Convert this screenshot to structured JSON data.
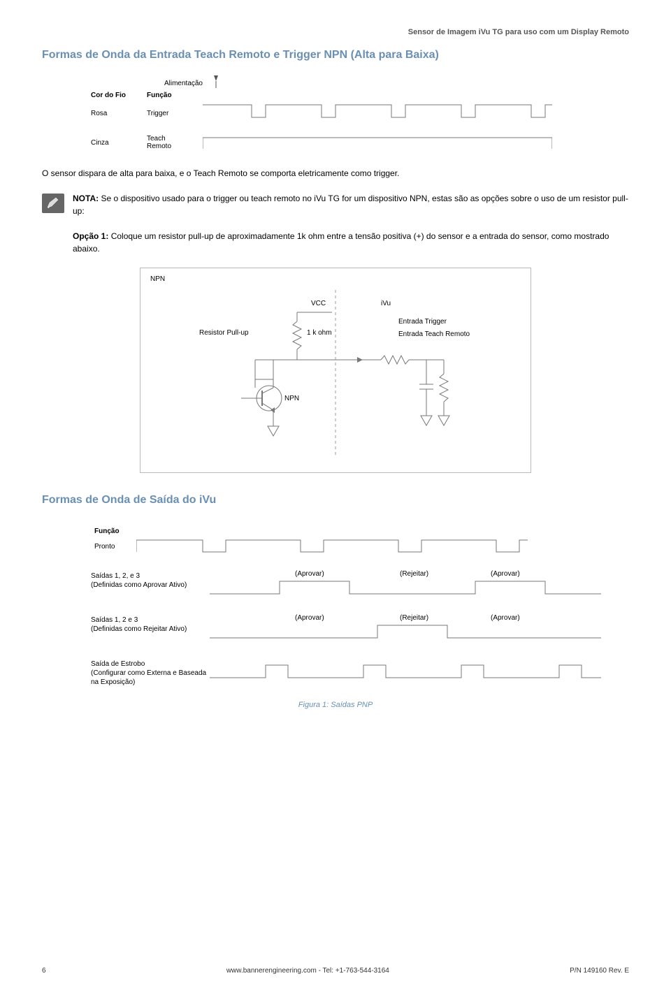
{
  "doc_header": "Sensor de Imagem iVu TG para uso com um Display Remoto",
  "section1_title": "Formas de Onda da Entrada Teach Remoto e Trigger NPN (Alta para Baixa)",
  "wave1": {
    "alimentacao": "Alimentação",
    "cor_do_fio": "Cor do Fio",
    "funcao": "Função",
    "rosa": "Rosa",
    "trigger": "Trigger",
    "cinza": "Cinza",
    "teach": "Teach",
    "remoto": "Remoto"
  },
  "para_after_wave": "O sensor dispara de alta para baixa, e o Teach Remoto se comporta eletricamente como trigger.",
  "note": {
    "prefix": "NOTA:",
    "line1": " Se o dispositivo usado para o trigger ou teach remoto no iVu TG for um dispositivo NPN, estas são as opções sobre o uso de um resistor pull-up:",
    "opcao_prefix": "Opção 1:",
    "opcao_text": " Coloque um resistor pull-up de aproximadamente 1k ohm entre a tensão positiva (+) do sensor e a entrada do sensor, como mostrado abaixo."
  },
  "circuit": {
    "npn": "NPN",
    "resistor": "Resistor Pull-up",
    "vcc": "VCC",
    "ohm": "1 k ohm",
    "ivu": "iVu",
    "entrada_trigger": "Entrada Trigger",
    "entrada_teach": "Entrada Teach Remoto",
    "npn2": "NPN"
  },
  "section2_title": "Formas de Onda de Saída do iVu",
  "output": {
    "funcao": "Função",
    "pronto": "Pronto",
    "saidas123a": "Saídas 1, 2, e 3",
    "def_aprovar": "(Definidas como Aprovar Ativo)",
    "saidas123b": "Saídas 1, 2 e 3",
    "def_rejeitar": "(Definidas como Rejeitar Ativo)",
    "estrobo1": "Saída de Estrobo",
    "estrobo2": "(Configurar como Externa e Baseada na Exposição)",
    "aprovar": "(Aprovar)",
    "rejeitar": "(Rejeitar)"
  },
  "figure_caption": "Figura 1: Saídas PNP",
  "footer": {
    "page": "6",
    "center": "www.bannerengineering.com - Tel: +1-763-544-3164",
    "right": "P/N 149160 Rev. E"
  }
}
